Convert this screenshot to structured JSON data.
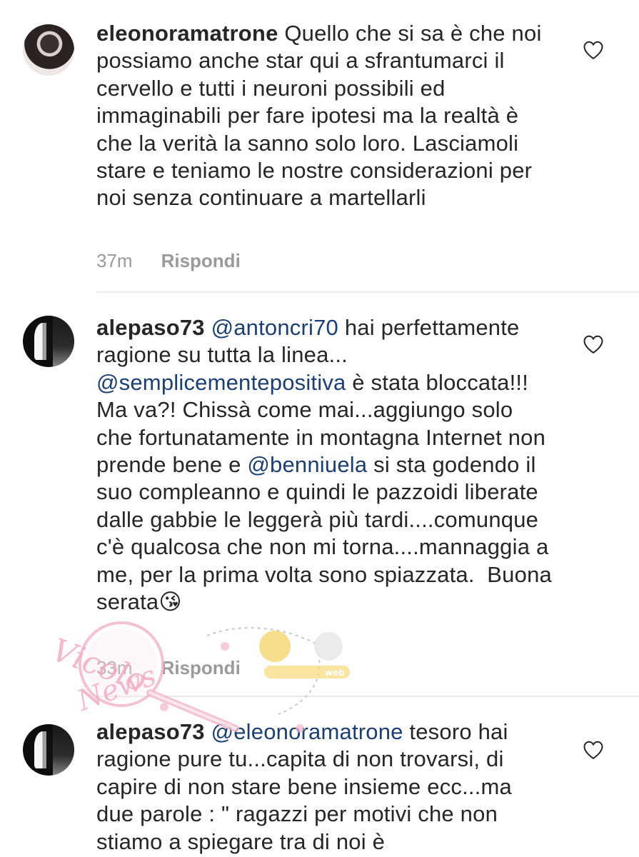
{
  "comments": [
    {
      "username": "eleonoramatrone",
      "body": "Quello che si sa è che noi possiamo anche star qui a sfrantumarci il cervello e tutti i neuroni possibili ed immaginabili per fare ipotesi ma la realtà è che la verità la sanno solo loro. Lasciamoli stare e teniamo le nostre considerazioni per noi senza continuare a martellarli",
      "time": "37m",
      "reply_label": "Rispondi"
    },
    {
      "username": "alepaso73",
      "mention1": "@antoncri70",
      "body1": " hai perfettamente ragione su tutta la linea... ",
      "mention2": "@semplicementepositiva",
      "body2": " è stata bloccata!!! Ma va?! Chissà come mai...aggiungo solo che fortunatamente in montagna Internet non prende bene e ",
      "mention3": "@benniuela",
      "body3": " si sta godendo il suo compleanno e quindi le pazzoidi liberate dalle gabbie le leggerà più tardi....comunque c'è qualcosa che non mi torna....mannaggia a me, per la prima volta sono spiazzata.  Buona serata",
      "emoji": "😘",
      "time": "33m",
      "reply_label": "Rispondi"
    },
    {
      "username": "alepaso73",
      "mention1": "@eleonoramatrone",
      "body1": " tesoro hai ragione pure tu...capita di non trovarsi, di capire di non stare bene insieme ecc...ma due parole : \" ragazzi per motivi che non stiamo a spiegare tra di noi è"
    }
  ],
  "icons": {
    "like": "heart-outline-icon"
  },
  "watermark": {
    "text1": "Vicolo",
    "text2": "News",
    "site": "web"
  },
  "colors": {
    "mention": "#1c3f73",
    "meta": "#9a9a9a",
    "divider": "#eaeaea",
    "watermark": "#f2b6c8"
  }
}
